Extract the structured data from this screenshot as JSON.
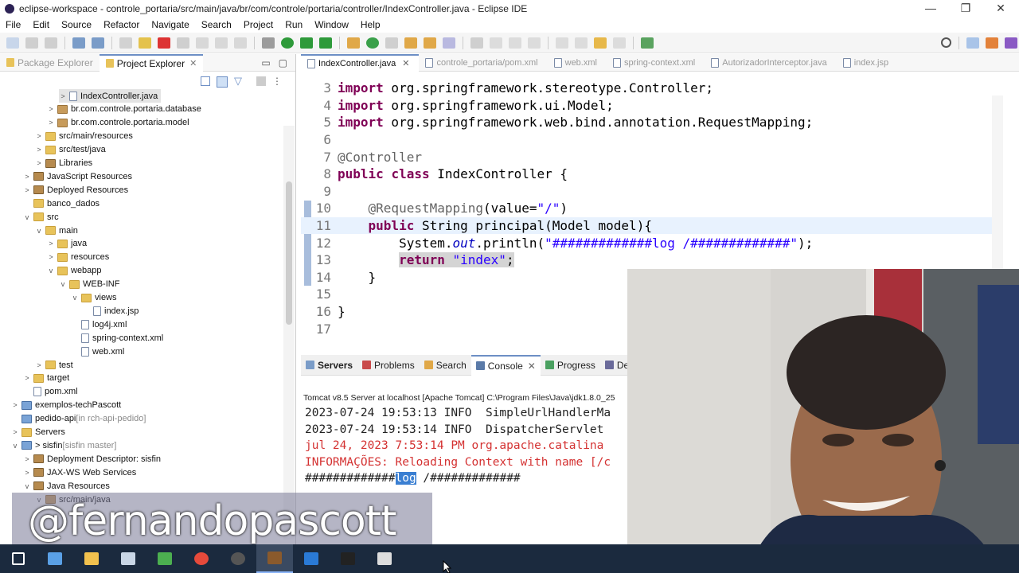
{
  "window": {
    "title": "eclipse-workspace - controle_portaria/src/main/java/br/com/controle/portaria/controller/IndexController.java - Eclipse IDE",
    "minimize": "—",
    "restore": "❐",
    "close": "✕"
  },
  "menu": [
    "File",
    "Edit",
    "Source",
    "Refactor",
    "Navigate",
    "Search",
    "Project",
    "Run",
    "Window",
    "Help"
  ],
  "left_tabs": [
    {
      "label": "Package Explorer"
    },
    {
      "label": "Project Explorer",
      "close": "✕"
    }
  ],
  "tree": [
    {
      "label": "IndexController.java",
      "indent": 4,
      "icon": "java-file",
      "twisty": ">"
    },
    {
      "label": "br.com.controle.portaria.database",
      "indent": 3,
      "icon": "package",
      "twisty": ">"
    },
    {
      "label": "br.com.controle.portaria.model",
      "indent": 3,
      "icon": "package",
      "twisty": ">"
    },
    {
      "label": "src/main/resources",
      "indent": 2,
      "icon": "folder",
      "twisty": ">"
    },
    {
      "label": "src/test/java",
      "indent": 2,
      "icon": "folder",
      "twisty": ">"
    },
    {
      "label": "Libraries",
      "indent": 2,
      "icon": "library",
      "twisty": ">"
    },
    {
      "label": "JavaScript Resources",
      "indent": 1,
      "icon": "library",
      "twisty": ">"
    },
    {
      "label": "Deployed Resources",
      "indent": 1,
      "icon": "library",
      "twisty": ">"
    },
    {
      "label": "banco_dados",
      "indent": 1,
      "icon": "folder",
      "twisty": ""
    },
    {
      "label": "src",
      "indent": 1,
      "icon": "folder",
      "twisty": "v"
    },
    {
      "label": "main",
      "indent": 2,
      "icon": "folder",
      "twisty": "v"
    },
    {
      "label": "java",
      "indent": 3,
      "icon": "folder",
      "twisty": ">"
    },
    {
      "label": "resources",
      "indent": 3,
      "icon": "folder",
      "twisty": ">"
    },
    {
      "label": "webapp",
      "indent": 3,
      "icon": "folder",
      "twisty": "v"
    },
    {
      "label": "WEB-INF",
      "indent": 4,
      "icon": "folder",
      "twisty": "v"
    },
    {
      "label": "views",
      "indent": 5,
      "icon": "folder",
      "twisty": "v"
    },
    {
      "label": "index.jsp",
      "indent": 6,
      "icon": "file",
      "twisty": ""
    },
    {
      "label": "log4j.xml",
      "indent": 5,
      "icon": "xml",
      "twisty": ""
    },
    {
      "label": "spring-context.xml",
      "indent": 5,
      "icon": "xml",
      "twisty": ""
    },
    {
      "label": "web.xml",
      "indent": 5,
      "icon": "xml",
      "twisty": ""
    },
    {
      "label": "test",
      "indent": 2,
      "icon": "folder",
      "twisty": ">"
    },
    {
      "label": "target",
      "indent": 1,
      "icon": "folder",
      "twisty": ">"
    },
    {
      "label": "pom.xml",
      "indent": 1,
      "icon": "xml",
      "twisty": ""
    },
    {
      "label": "exemplos-techPascott",
      "indent": 0,
      "icon": "project",
      "twisty": ">"
    },
    {
      "label": "pedido-api",
      "suffix": " [in rch-api-pedido]",
      "indent": 0,
      "icon": "project",
      "twisty": ""
    },
    {
      "label": "Servers",
      "indent": 0,
      "icon": "folder",
      "twisty": ">"
    },
    {
      "label": "> sisfin",
      "suffix": " [sisfin master]",
      "indent": 0,
      "icon": "project",
      "twisty": "v"
    },
    {
      "label": "Deployment Descriptor: sisfin",
      "indent": 1,
      "icon": "library",
      "twisty": ">"
    },
    {
      "label": "JAX-WS Web Services",
      "indent": 1,
      "icon": "library",
      "twisty": ">"
    },
    {
      "label": "Java Resources",
      "indent": 1,
      "icon": "library",
      "twisty": "v"
    },
    {
      "label": "src/main/java",
      "indent": 2,
      "icon": "package",
      "twisty": "v"
    }
  ],
  "editor_tabs": [
    {
      "label": "IndexController.java",
      "active": true,
      "close": "✕"
    },
    {
      "label": "controle_portaria/pom.xml"
    },
    {
      "label": "web.xml"
    },
    {
      "label": "spring-context.xml"
    },
    {
      "label": "AutorizadorInterceptor.java"
    },
    {
      "label": "index.jsp"
    }
  ],
  "code": [
    {
      "n": "3",
      "text": "import org.springframework.stereotype.Controller;"
    },
    {
      "n": "4",
      "text": "import org.springframework.ui.Model;"
    },
    {
      "n": "5",
      "text": "import org.springframework.web.bind.annotation.RequestMapping;"
    },
    {
      "n": "6",
      "text": ""
    },
    {
      "n": "7",
      "text": "@Controller"
    },
    {
      "n": "8",
      "text": "public class IndexController {"
    },
    {
      "n": "9",
      "text": ""
    },
    {
      "n": "10",
      "text": "    @RequestMapping(value=\"/\")"
    },
    {
      "n": "11",
      "text": "    public String principal(Model model){"
    },
    {
      "n": "12",
      "text": "        System.out.println(\"#############log /#############\");"
    },
    {
      "n": "13",
      "text": "        return \"index\";"
    },
    {
      "n": "14",
      "text": "    }"
    },
    {
      "n": "15",
      "text": ""
    },
    {
      "n": "16",
      "text": "}"
    },
    {
      "n": "17",
      "text": ""
    }
  ],
  "console_tabs": [
    {
      "label": "Servers"
    },
    {
      "label": "Problems"
    },
    {
      "label": "Search"
    },
    {
      "label": "Console",
      "active": true,
      "close": "✕"
    },
    {
      "label": "Progress"
    },
    {
      "label": "Debu"
    }
  ],
  "console_header": "Tomcat v8.5 Server at localhost [Apache Tomcat] C:\\Program Files\\Java\\jdk1.8.0_25",
  "console_lines": [
    {
      "text": "2023-07-24 19:53:13 INFO  SimpleUrlHandlerMa",
      "color": "black"
    },
    {
      "text": "2023-07-24 19:53:14 INFO  DispatcherServlet",
      "color": "black"
    },
    {
      "text": "jul 24, 2023 7:53:14 PM org.apache.catalina",
      "color": "red"
    },
    {
      "text": "INFORMAÇÕES: Reloading Context with name [/c",
      "color": "red"
    }
  ],
  "console_last": {
    "before": "#############",
    "selected": "log",
    "after": " /#############"
  },
  "watermark": "@fernandopascott",
  "taskbar_icons": [
    "windows-start-icon",
    "computer-icon",
    "file-explorer-icon",
    "notepad-icon",
    "sheet-icon",
    "chrome-icon",
    "obs-icon",
    "eclipse-icon",
    "vscode-icon",
    "terminal-icon",
    "settings-icon"
  ],
  "colors": {
    "keyword": "#7f0055",
    "annotation": "#646464",
    "string": "#2a00ff",
    "console_error": "#d43232",
    "selection": "#3a7fd2"
  }
}
